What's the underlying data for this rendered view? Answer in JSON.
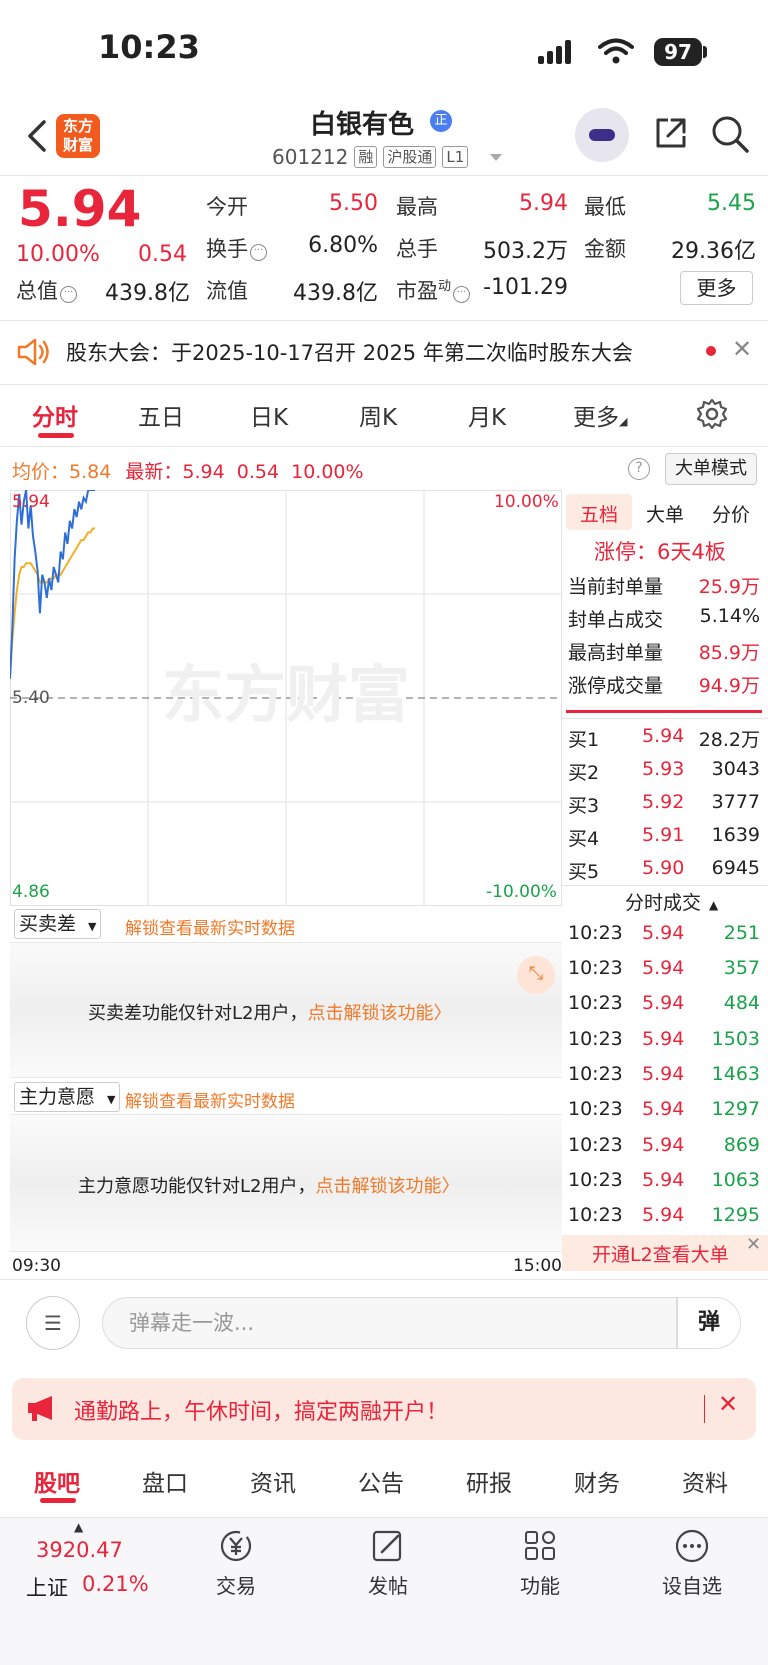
{
  "status_bar": {
    "time": "10:23",
    "battery": "97"
  },
  "header": {
    "stock_name": "白银有色",
    "badge": "正",
    "code": "601212",
    "tags": [
      "融",
      "沪股通",
      "L1"
    ],
    "logo_text": "东方财富"
  },
  "quote": {
    "price": "5.94",
    "change_pct": "10.00%",
    "change": "0.54",
    "stats": {
      "open_label": "今开",
      "open": "5.50",
      "high_label": "最高",
      "high": "5.94",
      "low_label": "最低",
      "low": "5.45",
      "turnover_label": "换手",
      "turnover": "6.80%",
      "volume_label": "总手",
      "volume": "503.2万",
      "amount_label": "金额",
      "amount": "29.36亿",
      "mktcap_label": "总值",
      "mktcap": "439.8亿",
      "float_label": "流值",
      "float": "439.8亿",
      "pe_label": "市盈",
      "pe_sup": "动",
      "pe": "-101.29"
    },
    "more": "更多"
  },
  "notice": {
    "text": "股东大会：于2025-10-17召开 2025 年第二次临时股东大会"
  },
  "tabs": [
    "分时",
    "五日",
    "日K",
    "周K",
    "月K",
    "更多"
  ],
  "chart_header": {
    "avg_label": "均价：",
    "avg": "5.84",
    "latest_label": "最新：",
    "latest": "5.94",
    "latest_chg": "0.54",
    "latest_pct": "10.00%",
    "help": "?",
    "big_mode": "大单模式"
  },
  "chart_axes": {
    "top_price": "5.94",
    "mid_price": "5.40",
    "bottom_price": "4.86",
    "top_pct": "10.00%",
    "bottom_pct": "-10.00%",
    "watermark": "东方财富",
    "time_start": "09:30",
    "time_end": "15:00"
  },
  "chart_data": {
    "type": "line",
    "ylim": [
      4.86,
      5.94
    ],
    "reference": 5.4,
    "x": [
      0,
      1,
      2,
      3,
      4,
      5,
      6,
      7,
      8,
      9,
      10,
      11,
      12,
      13,
      14,
      15,
      16,
      17,
      18,
      19,
      20,
      21,
      22,
      23,
      24,
      25,
      26,
      27,
      28,
      29,
      30,
      31,
      32,
      33,
      34,
      35,
      36,
      37
    ],
    "series": [
      {
        "values": [
          5.45,
          5.58,
          5.76,
          5.86,
          5.93,
          5.85,
          5.91,
          5.94,
          5.84,
          5.9,
          5.82,
          5.78,
          5.73,
          5.62,
          5.72,
          5.7,
          5.66,
          5.71,
          5.68,
          5.74,
          5.72,
          5.7,
          5.78,
          5.76,
          5.83,
          5.8,
          5.86,
          5.84,
          5.89,
          5.87,
          5.91,
          5.89,
          5.92,
          5.91,
          5.94,
          5.94,
          5.94,
          5.94
        ]
      },
      {
        "values": [
          5.45,
          5.55,
          5.62,
          5.68,
          5.72,
          5.74,
          5.74,
          5.75,
          5.75,
          5.75,
          5.74,
          5.73,
          5.72,
          5.7,
          5.7,
          5.7,
          5.7,
          5.71,
          5.71,
          5.71,
          5.72,
          5.72,
          5.72,
          5.73,
          5.74,
          5.75,
          5.76,
          5.77,
          5.78,
          5.79,
          5.8,
          5.81,
          5.81,
          5.82,
          5.83,
          5.83,
          5.84,
          5.84
        ]
      }
    ]
  },
  "right_panel": {
    "tabs": [
      "五档",
      "大单",
      "分价"
    ],
    "limit_up": "涨停：6天4板",
    "stats": [
      {
        "label": "当前封单量",
        "value": "25.9万"
      },
      {
        "label": "封单占成交",
        "value": "5.14%"
      },
      {
        "label": "最高封单量",
        "value": "85.9万"
      },
      {
        "label": "涨停成交量",
        "value": "94.9万"
      }
    ],
    "bids": [
      {
        "label": "买1",
        "price": "5.94",
        "vol": "28.2万"
      },
      {
        "label": "买2",
        "price": "5.93",
        "vol": "3043"
      },
      {
        "label": "买3",
        "price": "5.92",
        "vol": "3777"
      },
      {
        "label": "买4",
        "price": "5.91",
        "vol": "1639"
      },
      {
        "label": "买5",
        "price": "5.90",
        "vol": "6945"
      }
    ],
    "trades_header": "分时成交",
    "trades": [
      {
        "time": "10:23",
        "price": "5.94",
        "vol": "251"
      },
      {
        "time": "10:23",
        "price": "5.94",
        "vol": "357"
      },
      {
        "time": "10:23",
        "price": "5.94",
        "vol": "484"
      },
      {
        "time": "10:23",
        "price": "5.94",
        "vol": "1503"
      },
      {
        "time": "10:23",
        "price": "5.94",
        "vol": "1463"
      },
      {
        "time": "10:23",
        "price": "5.94",
        "vol": "1297"
      },
      {
        "time": "10:23",
        "price": "5.94",
        "vol": "869"
      },
      {
        "time": "10:23",
        "price": "5.94",
        "vol": "1063"
      },
      {
        "time": "10:23",
        "price": "5.94",
        "vol": "1295"
      }
    ],
    "l2_banner": "开通L2查看大单"
  },
  "indicators": {
    "panel1_select": "买卖差",
    "panel1_hint": "解锁查看最新实时数据",
    "panel1_text": "买卖差功能仅针对L2用户，",
    "panel1_link": "点击解锁该功能〉",
    "panel2_select": "主力意愿",
    "panel2_hint": "解锁查看最新实时数据",
    "panel2_text": "主力意愿功能仅针对L2用户，",
    "panel2_link": "点击解锁该功能〉"
  },
  "danmaku": {
    "placeholder": "弹幕走一波...",
    "send": "弹"
  },
  "promo": {
    "text": "通勤路上，午休时间，搞定两融开户！"
  },
  "bottom_tabs": [
    "股吧",
    "盘口",
    "资讯",
    "公告",
    "研报",
    "财务",
    "资料"
  ],
  "bottom_nav": {
    "index_value": "3920.47",
    "index_name": "上证",
    "index_pct": "0.21%",
    "items": [
      "交易",
      "发帖",
      "功能",
      "设自选"
    ]
  },
  "colors": {
    "up": "#e8253a",
    "down": "#1aa34a",
    "accent": "#f07a2a",
    "price_line": "#2f6fd6",
    "avg_line": "#f2b02a"
  }
}
